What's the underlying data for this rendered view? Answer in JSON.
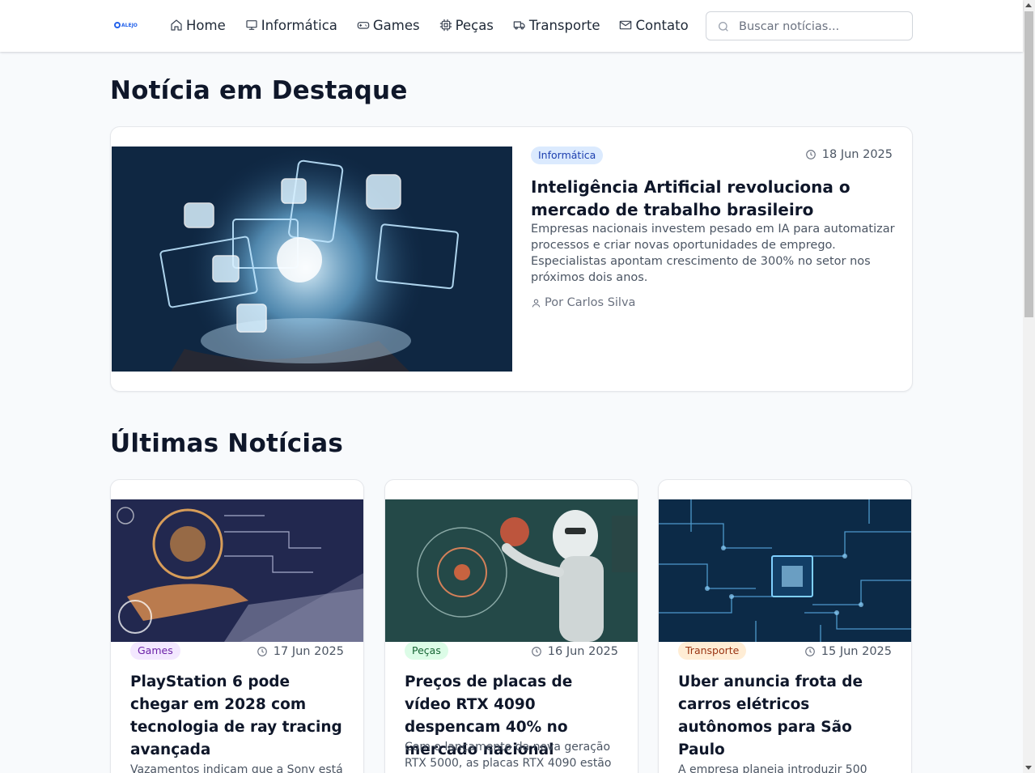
{
  "navbar": {
    "logo_text": "ALEJO",
    "links": [
      {
        "label": "Home",
        "icon": "home-icon"
      },
      {
        "label": "Informática",
        "icon": "monitor-icon"
      },
      {
        "label": "Games",
        "icon": "gamepad-icon"
      },
      {
        "label": "Peças",
        "icon": "cpu-icon"
      },
      {
        "label": "Transporte",
        "icon": "truck-icon"
      },
      {
        "label": "Contato",
        "icon": "mail-icon"
      }
    ],
    "search_placeholder": "Buscar notícias..."
  },
  "featured": {
    "section_title": "Notícia em Destaque",
    "category": "Informática",
    "date": "18 Jun 2025",
    "title": "Inteligência Artificial revoluciona o mercado de trabalho brasileiro",
    "excerpt": "Empresas nacionais investem pesado em IA para automatizar processos e criar novas oportunidades de emprego. Especialistas apontam crescimento de 300% no setor nos próximos dois anos.",
    "author": "Por Carlos Silva"
  },
  "latest": {
    "section_title": "Últimas Notícias",
    "cards": [
      {
        "category": "Games",
        "date": "17 Jun 2025",
        "title": "PlayStation 6 pode chegar em 2028 com tecnologia de ray tracing avançada",
        "excerpt": "Vazamentos indicam que a Sony está"
      },
      {
        "category": "Peças",
        "date": "16 Jun 2025",
        "title": "Preços de placas de vídeo RTX 4090 despencam 40% no mercado nacional",
        "excerpt": "Com o lançamento da nova geração RTX 5000, as placas RTX 4090 estão"
      },
      {
        "category": "Transporte",
        "date": "15 Jun 2025",
        "title": "Uber anuncia frota de carros elétricos autônomos para São Paulo",
        "excerpt": "A empresa planeja introduzir 500"
      }
    ]
  },
  "colors": {
    "page_bg": "#f8fafc",
    "badge_info": "#dbeafe",
    "badge_games": "#f3e8ff",
    "badge_pecas": "#dcfce7",
    "badge_transporte": "#ffedd5"
  }
}
